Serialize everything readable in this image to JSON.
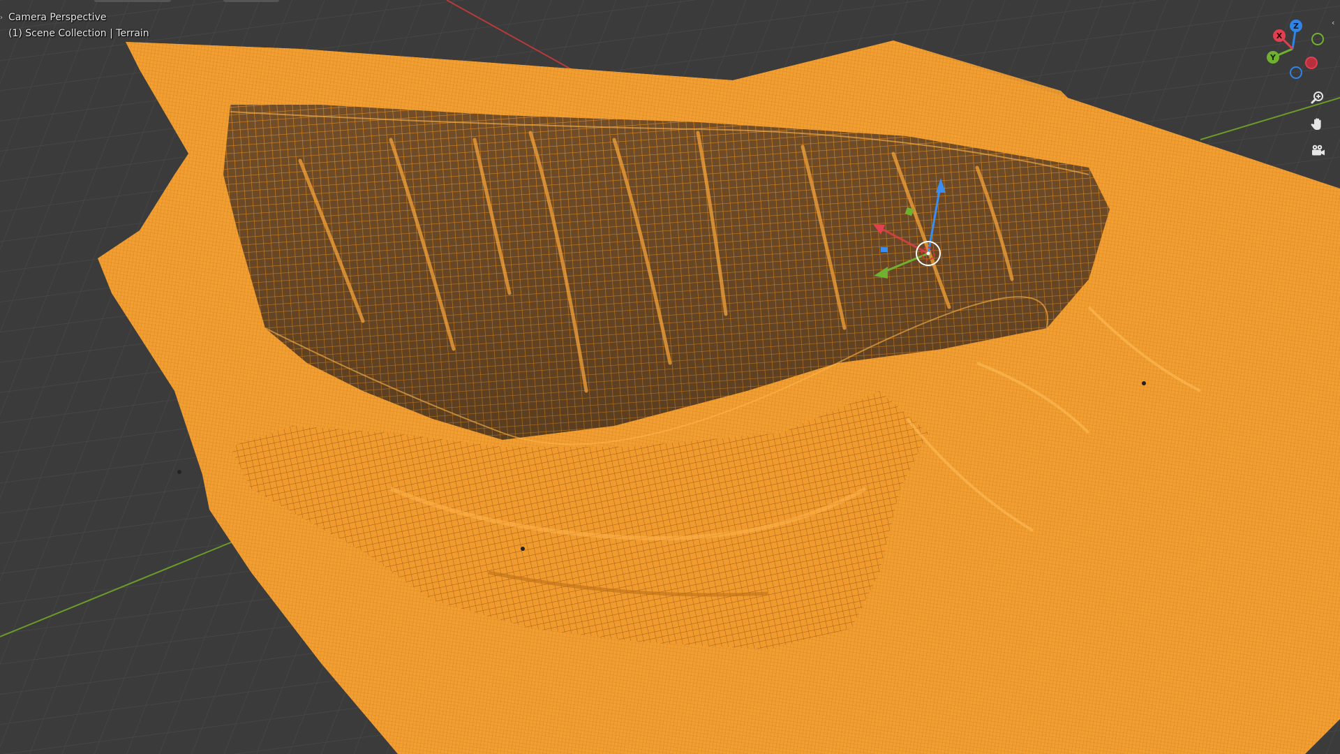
{
  "viewport": {
    "title": "Camera Perspective",
    "collection": "(1) Scene Collection | Terrain",
    "background_color": "#3d3d3d",
    "grid_color": "#4a4a4a",
    "x_axis_color": "#b83a3a",
    "y_axis_color": "#6c9a2a",
    "mesh_color": "#f09a30",
    "mesh_wire_color": "#8a4e10"
  },
  "gizmo": {
    "z_label": "Z",
    "y_label": "Y",
    "x_label": "X",
    "z_color": "#2f84e6",
    "y_color": "#70b230",
    "x_color": "#e0404f",
    "tools": [
      {
        "name": "zoom",
        "icon": "zoom-in-icon"
      },
      {
        "name": "pan",
        "icon": "hand-icon"
      },
      {
        "name": "camera",
        "icon": "camera-icon"
      }
    ]
  },
  "object_gizmo": {
    "icon": "object-origin-icon"
  }
}
